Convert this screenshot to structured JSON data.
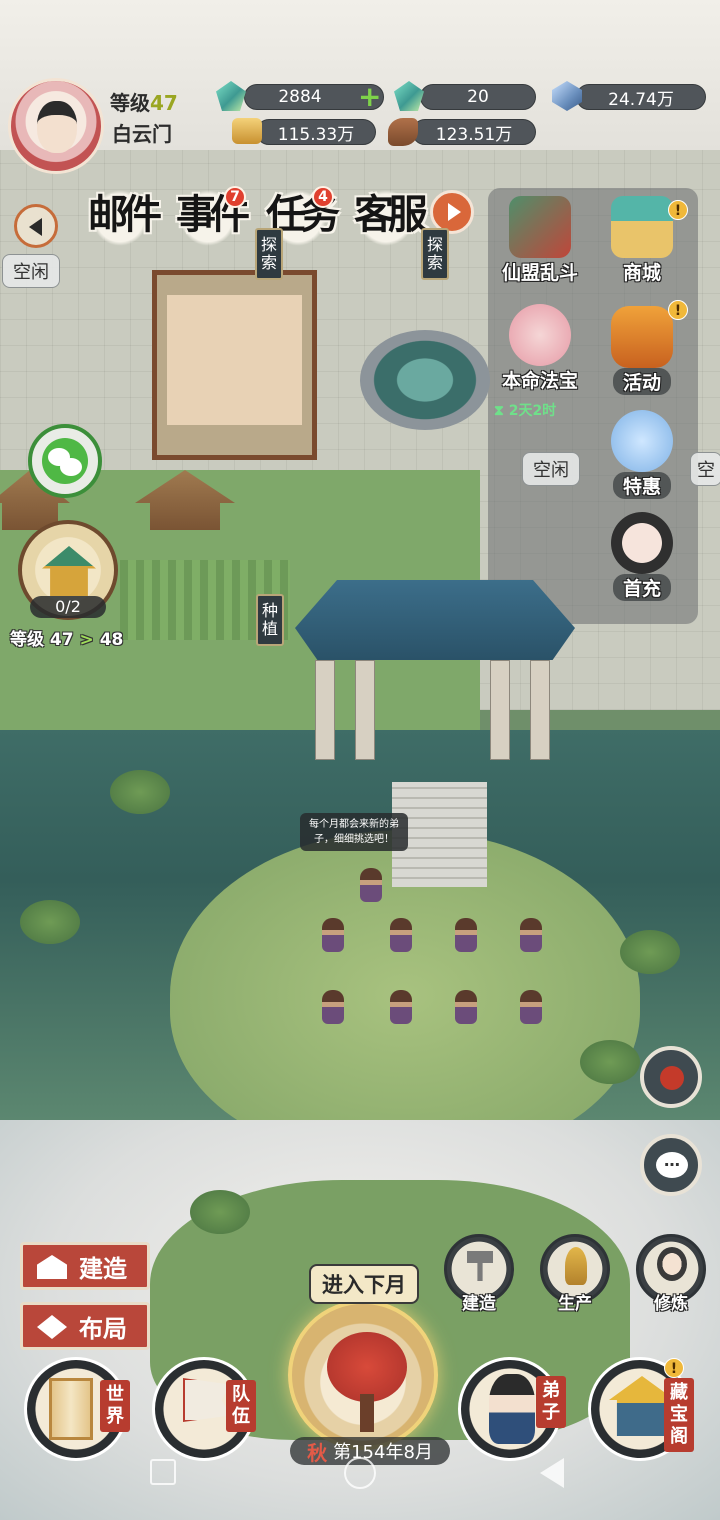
{
  "player": {
    "level_label": "等级",
    "level": "47",
    "sect": "白云门"
  },
  "resources": {
    "jade": "2884",
    "spirit_stone": "20",
    "crystal": "24.74万",
    "gold": "115.33万",
    "wood": "123.51万"
  },
  "top_tabs": [
    {
      "label": "邮件",
      "badge": ""
    },
    {
      "label": "事件",
      "badge": "7"
    },
    {
      "label": "任务",
      "badge": "4"
    },
    {
      "label": "客服",
      "badge": ""
    }
  ],
  "scene_signs": {
    "explore_left": "探索",
    "explore_right": "探索",
    "plant": "种植"
  },
  "idle_bubbles": {
    "left": "空闲",
    "right": "空闲",
    "far_right": "空"
  },
  "right_menu": {
    "alliance": "仙盟乱斗",
    "shop": "商城",
    "treasure": "本命法宝",
    "timer": "2天2时",
    "event": "活动",
    "deal": "特惠",
    "first_charge": "首充"
  },
  "building_upgrade": {
    "progress": "0/2",
    "level_label": "等级",
    "from": "47",
    "to": "48"
  },
  "speech": "每个月都会来新的弟子，细细挑选吧！",
  "left_buttons": {
    "build": "建造",
    "layout": "布局"
  },
  "quick_buttons": {
    "build": "建造",
    "produce": "生产",
    "cultivate": "修炼"
  },
  "next_month": "进入下月",
  "date": {
    "season": "秋",
    "text": "第154年8月"
  },
  "bottom_nav": {
    "world": "世界",
    "team": "队伍",
    "disciple": "弟子",
    "treasure_hall": "藏宝阁"
  },
  "colors": {
    "accent_red": "#b9473a",
    "level_green": "#9aa622",
    "badge_red": "#e0402f",
    "season_red": "#e35a47"
  }
}
